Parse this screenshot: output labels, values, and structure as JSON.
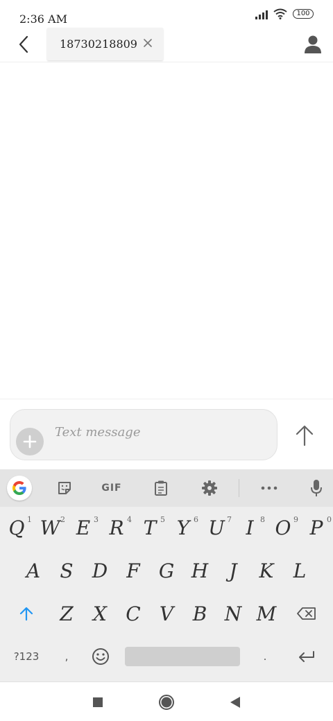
{
  "status_bar": {
    "time": "2:36 AM",
    "battery": "100"
  },
  "header": {
    "recipient": "18730218809"
  },
  "compose": {
    "placeholder": "Text message"
  },
  "keyboard": {
    "toolbar": {
      "gif_label": "GIF"
    },
    "row1": [
      {
        "label": "Q",
        "hint": "1"
      },
      {
        "label": "W",
        "hint": "2"
      },
      {
        "label": "E",
        "hint": "3"
      },
      {
        "label": "R",
        "hint": "4"
      },
      {
        "label": "T",
        "hint": "5"
      },
      {
        "label": "Y",
        "hint": "6"
      },
      {
        "label": "U",
        "hint": "7"
      },
      {
        "label": "I",
        "hint": "8"
      },
      {
        "label": "O",
        "hint": "9"
      },
      {
        "label": "P",
        "hint": "0"
      }
    ],
    "row2": [
      "A",
      "S",
      "D",
      "F",
      "G",
      "H",
      "J",
      "K",
      "L"
    ],
    "row3": [
      "Z",
      "X",
      "C",
      "V",
      "B",
      "N",
      "M"
    ],
    "row4": {
      "symbols_label": "?123",
      "comma": ",",
      "period": "."
    }
  },
  "icons": {
    "back": "back-arrow-icon",
    "clear": "close-icon",
    "contact": "person-icon",
    "add": "plus-icon",
    "send": "arrow-up-icon",
    "sticker": "sticker-icon",
    "clipboard": "clipboard-icon",
    "settings": "gear-icon",
    "more": "more-icon",
    "mic": "microphone-icon",
    "shift": "shift-icon",
    "backspace": "backspace-icon",
    "emoji": "emoji-icon",
    "enter": "enter-icon"
  },
  "colors": {
    "accent": "#2196f3",
    "keyboard_bg": "#eeeeee",
    "toolbar_bg": "#e4e4e4"
  }
}
